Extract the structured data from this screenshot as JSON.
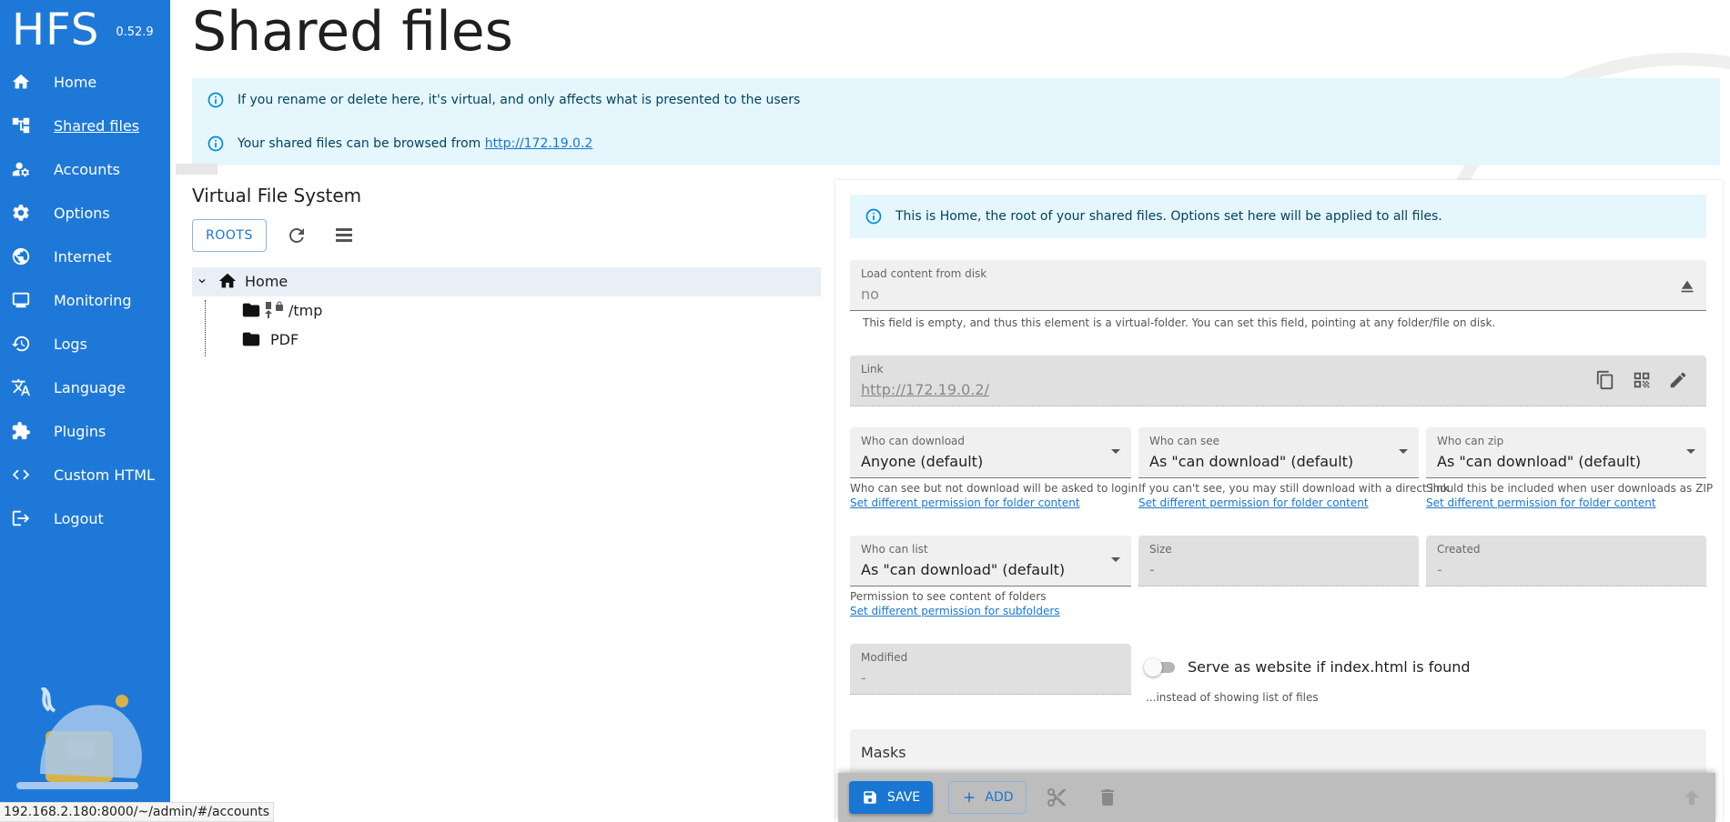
{
  "app": {
    "name": "HFS",
    "version": "0.52.9"
  },
  "sidebar": {
    "items": [
      {
        "label": "Home",
        "icon": "home-icon"
      },
      {
        "label": "Shared files",
        "icon": "tree-icon",
        "active": true
      },
      {
        "label": "Accounts",
        "icon": "accounts-icon"
      },
      {
        "label": "Options",
        "icon": "gear-icon"
      },
      {
        "label": "Internet",
        "icon": "globe-icon"
      },
      {
        "label": "Monitoring",
        "icon": "monitor-icon"
      },
      {
        "label": "Logs",
        "icon": "history-icon"
      },
      {
        "label": "Language",
        "icon": "translate-icon"
      },
      {
        "label": "Plugins",
        "icon": "puzzle-icon"
      },
      {
        "label": "Custom HTML",
        "icon": "code-icon"
      },
      {
        "label": "Logout",
        "icon": "logout-icon"
      }
    ]
  },
  "page": {
    "title": "Shared files",
    "alert_virtual": "If you rename or delete here, it's virtual, and only affects what is presented to the users",
    "alert_browse_prefix": "Your shared files can be browsed from ",
    "alert_browse_link": "http://172.19.0.2"
  },
  "vfs": {
    "title": "Virtual File System",
    "roots_label": "ROOTS",
    "tree": {
      "root": "Home",
      "children": [
        {
          "name": "/tmp",
          "icons": [
            "folder-icon",
            "upload-icon",
            "lock-icon"
          ]
        },
        {
          "name": "PDF",
          "icons": [
            "folder-icon"
          ]
        }
      ]
    }
  },
  "details": {
    "info": "This is Home, the root of your shared files. Options set here will be applied to all files.",
    "load_content": {
      "label": "Load content from disk",
      "value": "no",
      "helper": "This field is empty, and thus this element is a virtual-folder. You can set this field, pointing at any folder/file on disk."
    },
    "link": {
      "label": "Link",
      "value": "http://172.19.0.2/"
    },
    "who_download": {
      "label": "Who can download",
      "value": "Anyone (default)",
      "helper": "Who can see but not download will be asked to login",
      "link": "Set different permission for folder content"
    },
    "who_see": {
      "label": "Who can see",
      "value": "As \"can download\" (default)",
      "helper": "If you can't see, you may still download with a direct link",
      "link": "Set different permission for folder content"
    },
    "who_zip": {
      "label": "Who can zip",
      "value": "As \"can download\" (default)",
      "helper": "Should this be included when user downloads as ZIP",
      "link": "Set different permission for folder content"
    },
    "who_list": {
      "label": "Who can list",
      "value": "As \"can download\" (default)",
      "helper": "Permission to see content of folders",
      "link": "Set different permission for subfolders"
    },
    "size": {
      "label": "Size",
      "value": "-"
    },
    "created": {
      "label": "Created",
      "value": "-"
    },
    "modified": {
      "label": "Modified",
      "value": "-"
    },
    "serve_website": {
      "label": "Serve as website if index.html is found",
      "helper": "...instead of showing list of files",
      "checked": false
    },
    "masks_label": "Masks"
  },
  "actions": {
    "save_label": "SAVE",
    "add_label": "ADD"
  },
  "statusbar": {
    "url": "192.168.2.180:8000/~/admin/#/accounts"
  },
  "colors": {
    "sidebar": "#1e78d8",
    "accent": "#1976d2",
    "alert_bg": "#e5f6fd"
  }
}
